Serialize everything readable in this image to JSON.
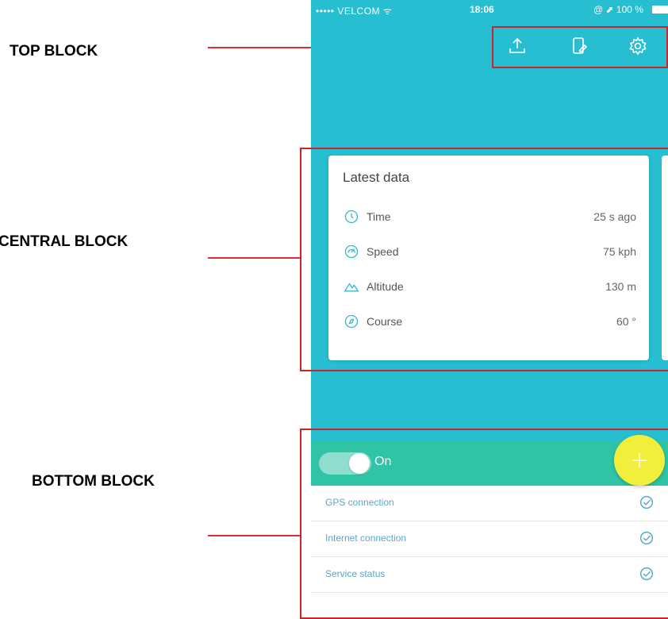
{
  "annotations": {
    "top_block": "TOP BLOCK",
    "central_block": "CENTRAL BLOCK",
    "bottom_block": "BOTTOM BLOCK",
    "line_color": "#e0313a",
    "outline_color": "#c9262d"
  },
  "status_bar": {
    "carrier": "••••• VELCOM ᯤ",
    "time": "18:06",
    "right": "@ ⬈ 100 %"
  },
  "top_bar": {
    "icons": [
      "upload-icon",
      "phone-edit-icon",
      "gear-icon"
    ]
  },
  "latest_data": {
    "title": "Latest data",
    "rows": [
      {
        "icon": "clock-icon",
        "label": "Time",
        "value": "25 s ago"
      },
      {
        "icon": "speedometer-icon",
        "label": "Speed",
        "value": "75 kph"
      },
      {
        "icon": "mountain-icon",
        "label": "Altitude",
        "value": "130 m"
      },
      {
        "icon": "compass-icon",
        "label": "Course",
        "value": "60 °"
      }
    ]
  },
  "tracking": {
    "toggle_state": "On"
  },
  "status_list": [
    {
      "label": "GPS connection",
      "icon": "check-circle-icon"
    },
    {
      "label": "Internet connection",
      "icon": "check-circle-icon"
    },
    {
      "label": "Service status",
      "icon": "check-circle-icon"
    }
  ],
  "colors": {
    "background": "#27bed1",
    "on_bar": "#2ec4a5",
    "fab": "#f2ef3c",
    "status_text": "#5aa8c8"
  }
}
